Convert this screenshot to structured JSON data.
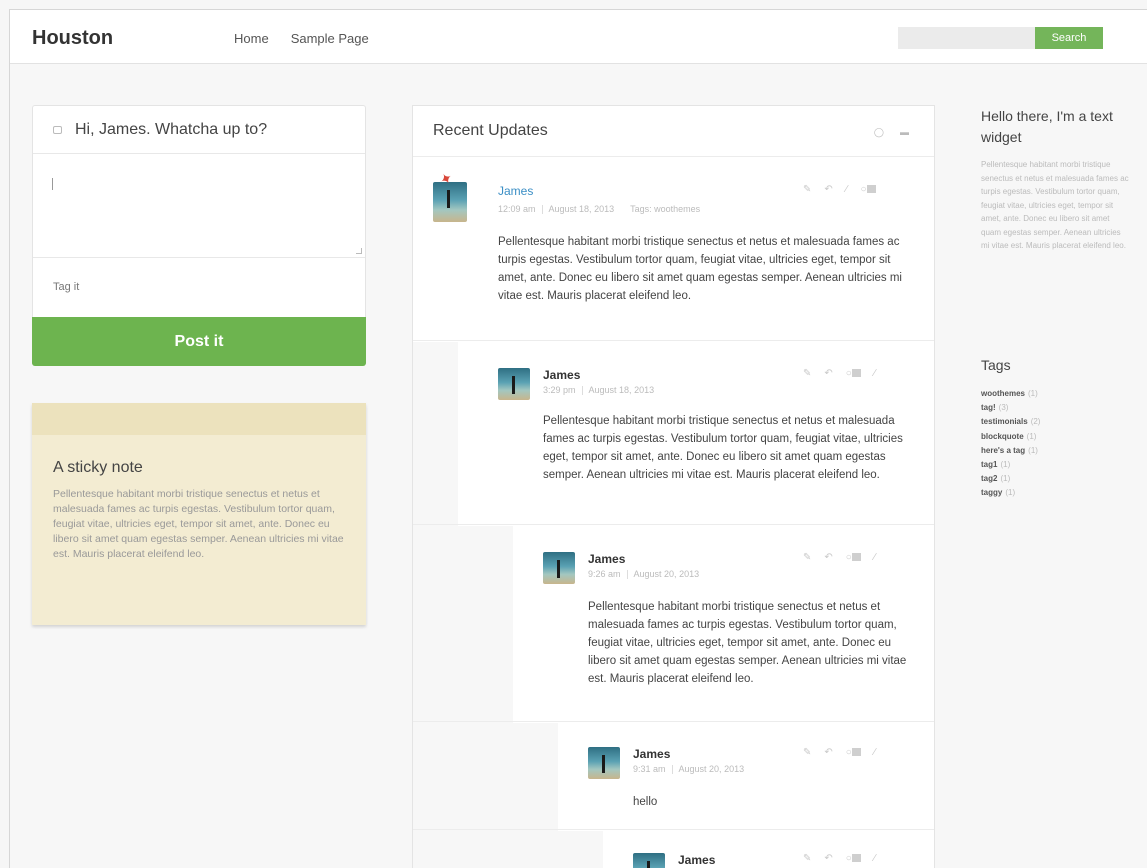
{
  "header": {
    "logo": "Houston",
    "nav": [
      "Home",
      "Sample Page"
    ],
    "search_placeholder": "",
    "search_button": "Search"
  },
  "composer": {
    "prompt": "Hi, James. Whatcha up to?",
    "textarea_value": "",
    "tag_placeholder": "Tag it",
    "post_button": "Post it"
  },
  "sticky": {
    "title": "A sticky note",
    "body": "Pellentesque habitant morbi tristique senectus et netus et malesuada fames ac turpis egestas. Vestibulum tortor quam, feugiat vitae, ultricies eget, tempor sit amet, ante. Donec eu libero sit amet quam egestas semper. Aenean ultricies mi vitae est. Mauris placerat eleifend leo."
  },
  "updates": {
    "title": "Recent Updates",
    "posts": [
      {
        "author": "James",
        "time": "12:09 am",
        "date": "August 18, 2013",
        "tags": "Tags: woothemes",
        "body": "Pellentesque habitant morbi tristique senectus et netus et malesuada fames ac turpis egestas. Vestibulum tortor quam, feugiat vitae, ultricies eget, tempor sit amet, ante. Donec eu libero sit amet quam egestas semper. Aenean ultricies mi vitae est. Mauris placerat eleifend leo."
      },
      {
        "author": "James",
        "time": "3:29 pm",
        "date": "August 18, 2013",
        "body": "Pellentesque habitant morbi tristique senectus et netus et malesuada fames ac turpis egestas. Vestibulum tortor quam, feugiat vitae, ultricies eget, tempor sit amet, ante. Donec eu libero sit amet quam egestas semper. Aenean ultricies mi vitae est. Mauris placerat eleifend leo."
      },
      {
        "author": "James",
        "time": "9:26 am",
        "date": "August 20, 2013",
        "body": "Pellentesque habitant morbi tristique senectus et netus et malesuada fames ac turpis egestas. Vestibulum tortor quam, feugiat vitae, ultricies eget, tempor sit amet, ante. Donec eu libero sit amet quam egestas semper. Aenean ultricies mi vitae est. Mauris placerat eleifend leo."
      },
      {
        "author": "James",
        "time": "9:31 am",
        "date": "August 20, 2013",
        "body": "hello"
      },
      {
        "author": "James",
        "time": "",
        "date": "",
        "body": ""
      }
    ]
  },
  "widget": {
    "title": "Hello there, I'm a text widget",
    "body": "Pellentesque habitant morbi tristique senectus et netus et malesuada fames ac turpis egestas. Vestibulum tortor quam, feugiat vitae, ultricies eget, tempor sit amet, ante. Donec eu libero sit amet quam egestas semper. Aenean ultricies mi vitae est. Mauris placerat eleifend leo."
  },
  "tags": {
    "title": "Tags",
    "items": [
      {
        "name": "woothemes",
        "count": "(1)"
      },
      {
        "name": "tag!",
        "count": "(3)"
      },
      {
        "name": "testimonials",
        "count": "(2)"
      },
      {
        "name": "blockquote",
        "count": "(1)"
      },
      {
        "name": "here's a tag",
        "count": "(1)"
      },
      {
        "name": "tag1",
        "count": "(1)"
      },
      {
        "name": "tag2",
        "count": "(1)"
      },
      {
        "name": "taggy",
        "count": "(1)"
      }
    ]
  },
  "colors": {
    "accent_green": "#6db44f",
    "link_blue": "#3a8ec5",
    "sticky_bg": "#f3ecd2"
  },
  "icons": {
    "composer": "chat-bubble-icon",
    "post_actions": [
      "quote-icon",
      "reply-icon",
      "edit-icon",
      "comment-count-icon"
    ],
    "updates_head": [
      "refresh-icon",
      "list-view-icon"
    ]
  }
}
